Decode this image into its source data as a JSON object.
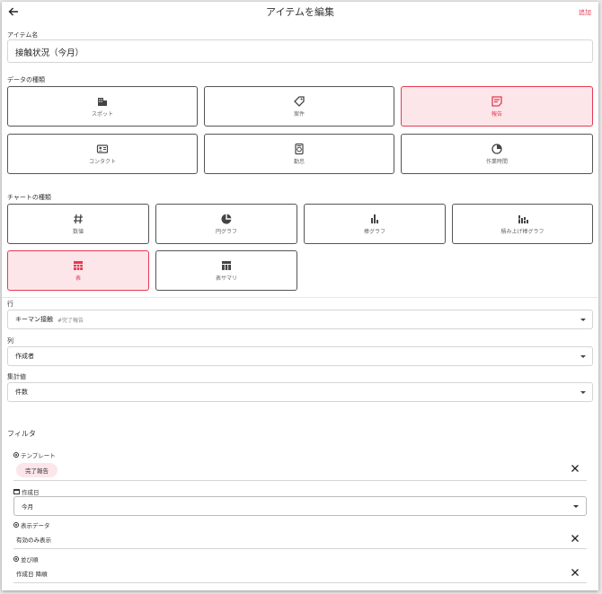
{
  "header": {
    "title": "アイテムを編集",
    "add_label": "追加"
  },
  "item_name": {
    "label": "アイテム名",
    "value": "接触状況（今月）"
  },
  "data_type": {
    "label": "データの種類",
    "options": [
      {
        "label": "スポット",
        "icon": "building-icon",
        "selected": false
      },
      {
        "label": "案件",
        "icon": "tag-icon",
        "selected": false
      },
      {
        "label": "報告",
        "icon": "note-icon",
        "selected": true
      },
      {
        "label": "コンタクト",
        "icon": "contact-card-icon",
        "selected": false
      },
      {
        "label": "勤怠",
        "icon": "timecard-icon",
        "selected": false
      },
      {
        "label": "作業時間",
        "icon": "clock-icon",
        "selected": false
      }
    ]
  },
  "chart_type": {
    "label": "チャートの種類",
    "options": [
      {
        "label": "数値",
        "icon": "hash-icon",
        "selected": false
      },
      {
        "label": "円グラフ",
        "icon": "pie-chart-icon",
        "selected": false
      },
      {
        "label": "棒グラフ",
        "icon": "bar-chart-icon",
        "selected": false
      },
      {
        "label": "積み上げ棒グラフ",
        "icon": "stacked-bar-icon",
        "selected": false
      },
      {
        "label": "表",
        "icon": "table-icon",
        "selected": true
      },
      {
        "label": "表サマリ",
        "icon": "table-summary-icon",
        "selected": false
      }
    ]
  },
  "row": {
    "label": "行",
    "value": "キーマン接触",
    "sub": "#完了報告"
  },
  "column": {
    "label": "列",
    "value": "作成者"
  },
  "aggregate": {
    "label": "集計値",
    "value": "件数"
  },
  "filter": {
    "title": "フィルタ",
    "template": {
      "label": "テンプレート",
      "chip": "完了報告"
    },
    "created_date": {
      "label": "作成日",
      "value": "今月"
    },
    "display_data": {
      "label": "表示データ",
      "value": "有効のみ表示"
    },
    "sort_order": {
      "label": "並び順",
      "value": "作成日 降順"
    }
  },
  "colors": {
    "accent": "#e53950",
    "selected_bg": "#fce6ea"
  }
}
